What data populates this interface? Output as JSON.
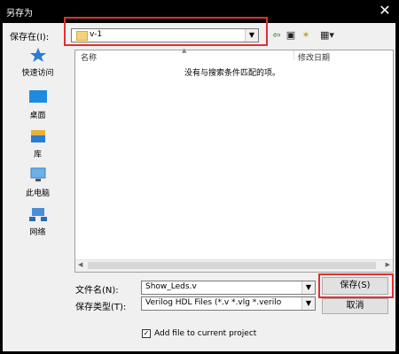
{
  "window": {
    "title": "另存为",
    "close_glyph": "✕"
  },
  "toolbar": {
    "save_in_label": "保存在(I):",
    "save_in_value": "v-1",
    "back_glyph": "⇦",
    "up_glyph": "▣",
    "new_folder_glyph": "✶",
    "view_menu_glyph": "▦▾"
  },
  "places": [
    {
      "label": "快速访问",
      "icon": "star-icon"
    },
    {
      "label": "桌面",
      "icon": "desktop-icon"
    },
    {
      "label": "库",
      "icon": "library-icon"
    },
    {
      "label": "此电脑",
      "icon": "computer-icon"
    },
    {
      "label": "网络",
      "icon": "network-icon"
    }
  ],
  "filelist": {
    "columns": {
      "name": "名称",
      "date": "修改日期"
    },
    "empty_message": "没有与搜索条件匹配的项。"
  },
  "form": {
    "filename_label": "文件名(N):",
    "filename_value": "Show_Leds.v",
    "filetype_label": "保存类型(T):",
    "filetype_value": "Verilog HDL Files (*.v *.vlg *.verilo"
  },
  "buttons": {
    "save": "保存(S)",
    "cancel": "取消"
  },
  "checkbox": {
    "label": "Add file to current project",
    "checked": true,
    "check_glyph": "✓"
  },
  "colors": {
    "highlight": "#e03030",
    "titlebar": "#000000",
    "dialog": "#f0f0f0"
  }
}
